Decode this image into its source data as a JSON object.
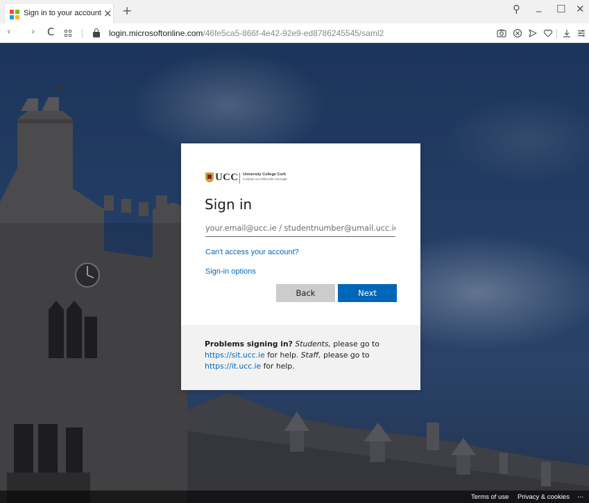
{
  "browser": {
    "tab_title": "Sign in to your account",
    "tab_close": "×",
    "new_tab": "+",
    "url_host": "login.microsoftonline.com",
    "url_path": "/46fe5ca5-866f-4e42-92e9-ed8786245545/saml2",
    "window_controls": {
      "search": "⚲",
      "minimize": "_",
      "maximize": "☐",
      "close": "✕"
    },
    "nav": {
      "back": "‹",
      "forward": "›",
      "reload": "C"
    },
    "favicon_colors": [
      "#f25022",
      "#7fba00",
      "#00a4ef",
      "#ffb900"
    ]
  },
  "org_logo": {
    "wordmark": "UCC",
    "name": "University College Cork",
    "irish_name": "Coláiste na hOllscoile Corcaigh"
  },
  "signin": {
    "title": "Sign in",
    "email_placeholder": "your.email@ucc.ie / studentnumber@umail.ucc.ie",
    "email_value": "",
    "cant_access_link": "Can't access your account?",
    "options_link": "Sign-in options",
    "back_button": "Back",
    "next_button": "Next"
  },
  "help": {
    "heading": "Problems signing in?",
    "students_label": "Students,",
    "students_text": " please go to ",
    "students_url": "https://sit.ucc.ie",
    "students_tail": " for help. ",
    "staff_label": "Staff,",
    "staff_text": " please go to ",
    "staff_url": "https://it.ucc.ie",
    "staff_tail": " for help."
  },
  "footer": {
    "terms": "Terms of use",
    "privacy": "Privacy & cookies",
    "more": "..."
  },
  "colors": {
    "accent": "#0067b8",
    "back_button_bg": "#cccccc",
    "help_panel_bg": "#f2f2f2"
  }
}
